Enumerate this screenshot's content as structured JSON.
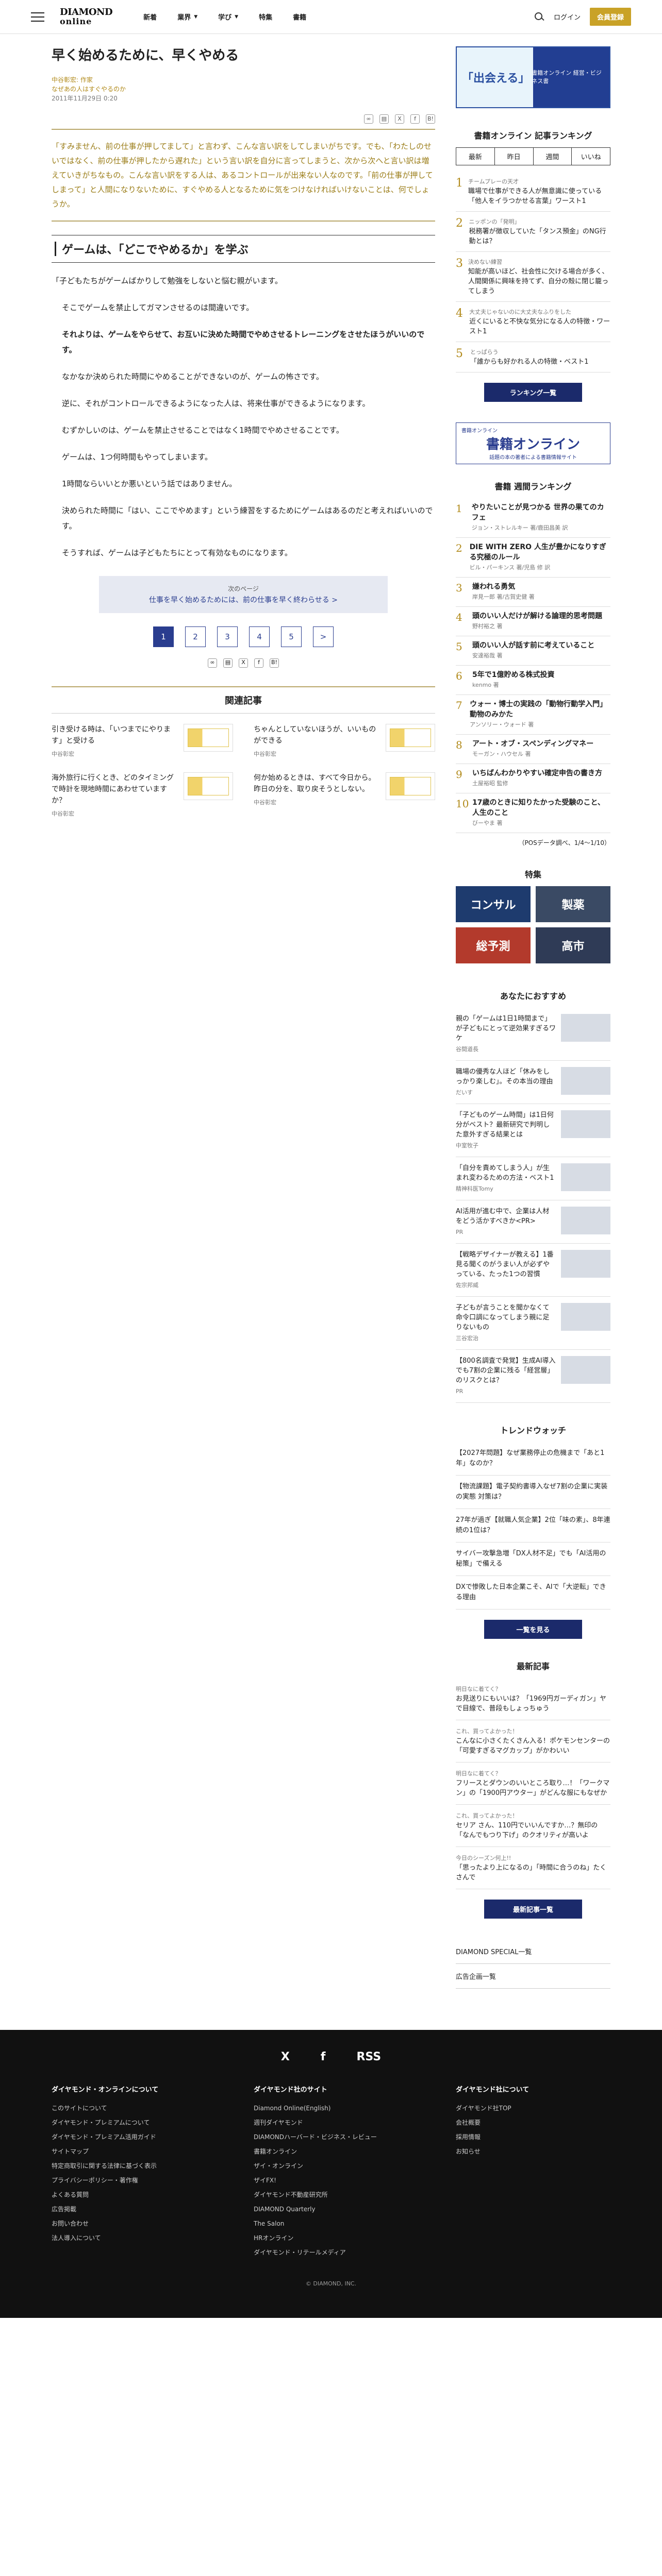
{
  "header": {
    "logo_line1": "DIAMOND",
    "logo_line2": "online",
    "nav": [
      "新着",
      "業界",
      "学び",
      "特集",
      "書籍"
    ],
    "login": "ログイン",
    "register": "会員登録"
  },
  "article": {
    "title": "早く始めるために、早くやめる",
    "author": "中谷彰宏: 作家",
    "series": "なぜあの人はすぐやるのか",
    "date": "2011年11月29日 0:20",
    "lead": "「すみません、前の仕事が押してまして」と言わず、こんな言い訳をしてしまいがちです。でも、「わたしのせいではなく、前の仕事が押したから遅れた」という言い訳を自分に言ってしまうと、次から次へと言い訳は増えていきがちなもの。こんな言い訳をする人は、あるコントロールが出来ない人なのです。「前の仕事が押してしまって」と人間になりないために、すぐやめる人となるために気をつけなければいけないことは、何でしょうか。",
    "section": "ゲームは、「どこでやめるか」を学ぶ",
    "paragraphs": [
      "「子どもたちがゲームばかりして勉強をしないと悩む親がいます。",
      "そこでゲームを禁止してガマンさせるのは間違いです。",
      "それよりは、ゲームをやらせて、お互いに決めた時間でやめさせるトレーニングをさせたほうがいいのです。",
      "なかなか決められた時間にやめることができないのが、ゲームの怖さです。",
      "逆に、それがコントロールできるようになった人は、将来仕事ができるようになります。",
      "むずかしいのは、ゲームを禁止させることではなく1時間でやめさせることです。",
      "ゲームは、1つ何時間もやってしまいます。",
      "1時間ならいいとか悪いという話ではありません。",
      "決められた時間に「はい、ここでやめます」という練習をするためにゲームはあるのだと考えればいいのです。",
      "そうすれば、ゲームは子どもたちにとって有効なものになります。"
    ],
    "next_label": "次のページ",
    "next_title": "仕事を早く始めるためには、前の仕事を早く終わらせる >",
    "pages": [
      "1",
      "2",
      "3",
      "4",
      "5",
      ">"
    ]
  },
  "share_icons": [
    "link-icon",
    "print-icon",
    "x-icon",
    "facebook-icon",
    "bookmark-icon"
  ],
  "related": {
    "heading": "関連記事",
    "items": [
      {
        "title": "引き受ける時は、「いつまでにやります」と受ける",
        "author": "中谷彰宏"
      },
      {
        "title": "ちゃんとしていないほうが、いいものができる",
        "author": "中谷彰宏"
      },
      {
        "title": "何か始めるときは、すべて今日から。昨日の分を、取り戻そうとしない。",
        "author": "中谷彰宏"
      },
      {
        "title": "海外旅行に行くとき、どのタイミングで時計を現地時間にあわせていますか？",
        "author": "中谷彰宏"
      }
    ]
  },
  "side": {
    "ad_left": "「出会える」",
    "ad_right": "書籍オンライン 経営・ビジネス書",
    "ranking_title": "書籍オンライン 記事ランキング",
    "ranking_tabs": [
      "最新",
      "昨日",
      "週間",
      "いいね"
    ],
    "ranking": [
      {
        "cat": "チームプレーの天才",
        "title": "職場で仕事ができる人が無意識に使っている「他人をイラつかせる言葉」ワースト1"
      },
      {
        "cat": "ニッポンの「発明」",
        "title": "税務署が徴収していた「タンス預金」のNG行動とは？"
      },
      {
        "cat": "決めない練習",
        "title": "知能が高いほど、社会性に欠ける場合が多く、人間関係に興味を持てず、自分の殻に閉じ籠ってしまう"
      },
      {
        "cat": "大丈夫じゃないのに大丈夫なふりをした",
        "title": "近くにいると不快な気分になる人の特徴・ワースト1"
      },
      {
        "cat": "とっぱらう",
        "title": "「誰からも好かれる人の特徴・ベスト1"
      }
    ],
    "ranking_btn": "ランキング一覧",
    "shoseki_top": "書籍オンライン",
    "shoseki_big": "書籍オンライン",
    "shoseki_sub": "話題の本の著者による書籍情報サイト",
    "book_title": "書籍 週間ランキング",
    "books": [
      {
        "t": "やりたいことが見つかる 世界の果てのカフェ",
        "a": "ジョン・ストレルキー 著/鹿田昌美 訳"
      },
      {
        "t": "DIE WITH ZERO 人生が豊かになりすぎる究極のルール",
        "a": "ビル・パーキンス 著/児島 修 訳"
      },
      {
        "t": "嫌われる勇気",
        "a": "岸見一郎 著/古賀史健 著"
      },
      {
        "t": "頭のいい人だけが解ける論理的思考問題",
        "a": "野村裕之 著"
      },
      {
        "t": "頭のいい人が話す前に考えていること",
        "a": "安達裕哉 著"
      },
      {
        "t": "5年で1億貯める株式投資",
        "a": "kenmo 著"
      },
      {
        "t": "ウォー・博士の実践の「動物行動学入門」動物のみかた",
        "a": "アンソリー・ウォード 著"
      },
      {
        "t": "アート・オブ・スペンディングマネー",
        "a": "モーガン・ハウセル 著"
      },
      {
        "t": "いちばんわかりやすい確定申告の書き方",
        "a": "土屋裕昭 監修"
      },
      {
        "t": "17歳のときに知りたかった受験のこと、人生のこと",
        "a": "びーやま 著"
      }
    ],
    "book_note": "（POSデータ調べ、1/4～1/10）",
    "tokushu_title": "特集",
    "tokushu": [
      "コンサル",
      "製薬",
      "総予測",
      "高市"
    ],
    "rec_title": "あなたにおすすめ",
    "recs": [
      {
        "t": "親の「ゲームは1日1時間まで」が子どもにとって逆効果すぎるワケ",
        "s": "谷間道長"
      },
      {
        "t": "職場の優秀な人ほど「休みをしっかり楽しむ」。その本当の理由",
        "s": "だいす"
      },
      {
        "t": "「子どものゲーム時間」は1日何分がベスト？最新研究で判明した意外すぎる結果とは",
        "s": "中室牧子"
      },
      {
        "t": "「自分を責めてしまう人」が生まれ変わるための方法・ベスト1",
        "s": "精神科医Tomy"
      },
      {
        "t": "AI活用が進む中で、企業は人材をどう活かすべきか<PR>",
        "s": "PR"
      },
      {
        "t": "【戦略デザイナーが教える】1番見る聞くのがうまい人が必ずやっている、たった1つの習慣",
        "s": "佐宗邦威"
      },
      {
        "t": "子どもが言うことを聞かなくて命令口調になってしまう親に足りないもの",
        "s": "三谷宏治"
      },
      {
        "t": "【800名調査で発覚】生成AI導入でも7割の企業に残る「経営層」のリスクとは？",
        "s": "PR"
      }
    ],
    "trend_title": "トレンドウォッチ",
    "trends": [
      "【2027年問題】なぜ業務停止の危機まで「あと1年」なのか？",
      "【物流課題】電子契約書導入なぜ7割の企業に実装の実態 対策は？",
      "27年が過ぎ【就職人気企業】2位「味の素」、8年連続の1位は？",
      "サイバー攻撃急増「DX人材不足」でも「AI活用の秘策」で備える",
      "DXで惨敗した日本企業こそ、AIで「大逆転」できる理由"
    ],
    "trend_btn": "一覧を見る",
    "latest_title": "最新記事",
    "latest": [
      {
        "d": "明日なに着てく？",
        "t": "お見送りにもいいは？「1969円ガーディガン」ヤで目線で、普段もしょっちゅう"
      },
      {
        "d": "これ、買ってよかった！",
        "t": "こんなに小さくたくさん入る！ポケモンセンターの「可愛すぎるマグカップ」がかわいい"
      },
      {
        "d": "明日なに着てく？",
        "t": "フリースとダウンのいいところ取り…！「ワークマン」の「1900円アウター」がどんな服にもなぜか"
      },
      {
        "d": "これ、買ってよかった！",
        "t": "セリア さん、110円でいいんですか…？無印の「なんでもつり下げ」のクオリティが高いよ"
      },
      {
        "d": "今日のシーズン何上!!",
        "t": "「思ったより上になるの」「時間に合うのね」たくさんで"
      }
    ],
    "latest_btn": "最新記事一覧",
    "links": [
      "DIAMOND SPECIAL一覧",
      "広告企画一覧"
    ]
  },
  "footer": {
    "sns": [
      "X",
      "f",
      "RSS"
    ],
    "col1_title": "ダイヤモンド・オンラインについて",
    "col1": [
      "このサイトについて",
      "ダイヤモンド・プレミアムについて",
      "ダイヤモンド・プレミアム活用ガイド",
      "サイトマップ",
      "特定商取引に関する法律に基づく表示",
      "プライバシーポリシー・著作権",
      "よくある質問",
      "広告掲載",
      "お問い合わせ",
      "法人導入について"
    ],
    "col2_title": "ダイヤモンド社のサイト",
    "col2": [
      "Diamond Online(English)",
      "週刊ダイヤモンド",
      "DIAMONDハーバード・ビジネス・レビュー",
      "書籍オンライン",
      "ザイ・オンライン",
      "ザイFX!",
      "ダイヤモンド不動産研究所",
      "DIAMOND Quarterly",
      "The Salon",
      "HRオンライン",
      "ダイヤモンド・リテールメディア"
    ],
    "col3_title": "ダイヤモンド社について",
    "col3": [
      "ダイヤモンド社TOP",
      "会社概要",
      "採用情報",
      "お知らせ"
    ],
    "copy": "© DIAMOND, INC."
  }
}
